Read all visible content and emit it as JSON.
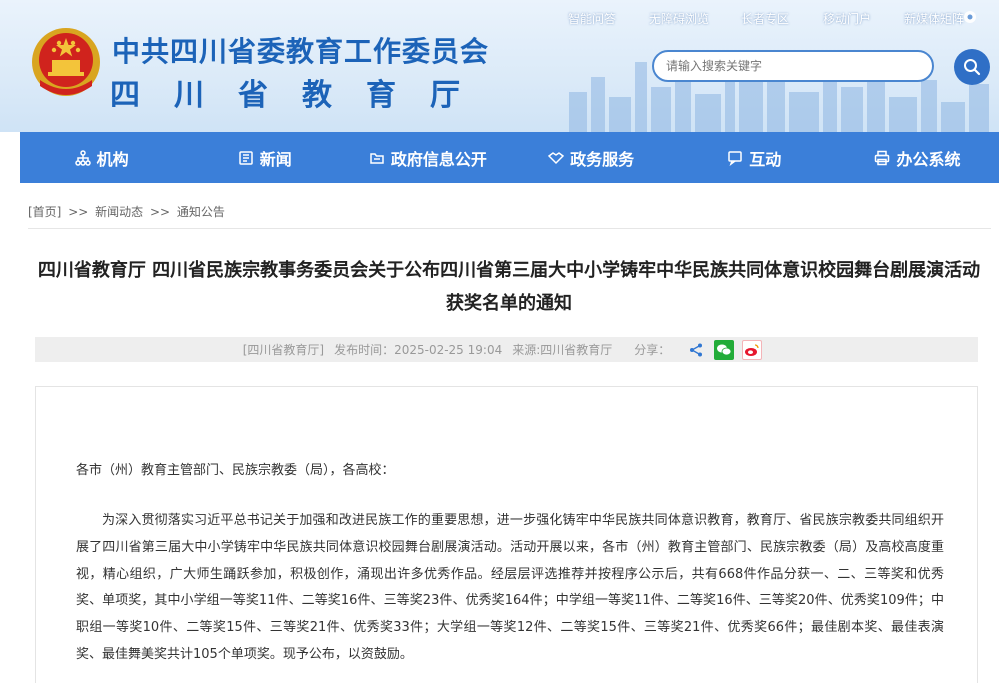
{
  "header": {
    "org_name_line1": "中共四川省委教育工作委员会",
    "org_name_line2": "四川省教育厅",
    "top_links": [
      "智能问答",
      "无障碍浏览",
      "长者专区",
      "移动门户",
      "新媒体矩阵"
    ],
    "search_placeholder": "请输入搜索关键字"
  },
  "nav": {
    "items": [
      {
        "label": "机构",
        "icon": "org-icon"
      },
      {
        "label": "新闻",
        "icon": "news-icon"
      },
      {
        "label": "政府信息公开",
        "icon": "folder-icon"
      },
      {
        "label": "政务服务",
        "icon": "handshake-icon"
      },
      {
        "label": "互动",
        "icon": "chat-icon"
      },
      {
        "label": "办公系统",
        "icon": "printer-icon"
      }
    ]
  },
  "breadcrumb": {
    "home": "[首页]",
    "sep": ">>",
    "level1": "新闻动态",
    "level2": "通知公告"
  },
  "article": {
    "title": "四川省教育厅 四川省民族宗教事务委员会关于公布四川省第三届大中小学铸牢中华民族共同体意识校园舞台剧展演活动获奖名单的通知",
    "publisher": "[四川省教育厅]",
    "publish_time": "发布时间：2025-02-25 19:04",
    "source": "来源:四川省教育厅",
    "share_label": "分享：",
    "salutation": "各市（州）教育主管部门、民族宗教委（局），各高校：",
    "paragraph1": "为深入贯彻落实习近平总书记关于加强和改进民族工作的重要思想，进一步强化铸牢中华民族共同体意识教育，教育厅、省民族宗教委共同组织开展了四川省第三届大中小学铸牢中华民族共同体意识校园舞台剧展演活动。活动开展以来，各市（州）教育主管部门、民族宗教委（局）及高校高度重视，精心组织，广大师生踊跃参加，积极创作，涌现出许多优秀作品。经层层评选推荐并按程序公示后，共有668件作品分获一、二、三等奖和优秀奖、单项奖，其中小学组一等奖11件、二等奖16件、三等奖23件、优秀奖164件；中学组一等奖11件、二等奖16件、三等奖20件、优秀奖109件；中职组一等奖10件、二等奖15件、三等奖21件、优秀奖33件；大学组一等奖12件、二等奖15件、三等奖21件、优秀奖66件；最佳剧本奖、最佳表演奖、最佳舞美奖共计105个单项奖。现予公布，以资鼓励。"
  },
  "colors": {
    "brand_blue": "#1c63b8",
    "nav_blue": "#3b7fd9",
    "wechat_green": "#22ac38",
    "weibo_red": "#e6162d"
  }
}
